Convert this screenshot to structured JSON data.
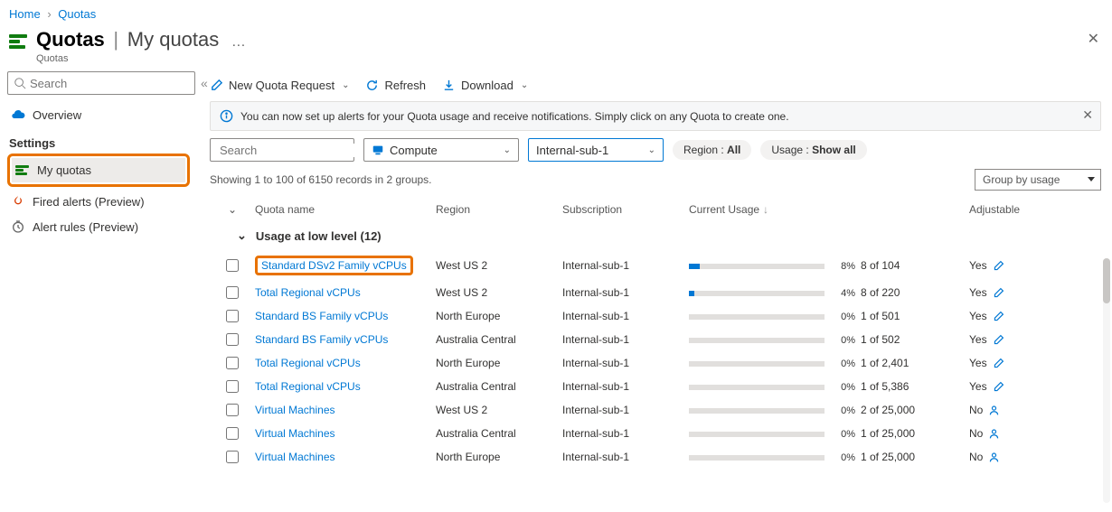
{
  "breadcrumb": {
    "home": "Home",
    "current": "Quotas"
  },
  "header": {
    "title": "Quotas",
    "subtitle": "My quotas",
    "service": "Quotas"
  },
  "sidebar": {
    "search_placeholder": "Search",
    "overview": "Overview",
    "section": "Settings",
    "my_quotas": "My quotas",
    "fired_alerts": "Fired alerts (Preview)",
    "alert_rules": "Alert rules (Preview)"
  },
  "toolbar": {
    "new": "New Quota Request",
    "refresh": "Refresh",
    "download": "Download"
  },
  "notice": "You can now set up alerts for your Quota usage and receive notifications. Simply click on any Quota to create one.",
  "filters": {
    "search_placeholder": "Search",
    "provider": "Compute",
    "subscription": "Internal-sub-1",
    "region_label": "Region :",
    "region_value": "All",
    "usage_label": "Usage :",
    "usage_value": "Show all"
  },
  "results": "Showing 1 to 100 of 6150 records in 2 groups.",
  "groupby": "Group by usage",
  "columns": {
    "name": "Quota name",
    "region": "Region",
    "sub": "Subscription",
    "usage": "Current Usage",
    "adj": "Adjustable"
  },
  "group_label": "Usage at low level (12)",
  "rows": [
    {
      "name": "Standard DSv2 Family vCPUs",
      "region": "West US 2",
      "sub": "Internal-sub-1",
      "pct": "8%",
      "fill": 8,
      "quota": "8 of 104",
      "adj": "Yes",
      "icon": "pen",
      "hl": true
    },
    {
      "name": "Total Regional vCPUs",
      "region": "West US 2",
      "sub": "Internal-sub-1",
      "pct": "4%",
      "fill": 4,
      "quota": "8 of 220",
      "adj": "Yes",
      "icon": "pen"
    },
    {
      "name": "Standard BS Family vCPUs",
      "region": "North Europe",
      "sub": "Internal-sub-1",
      "pct": "0%",
      "fill": 0,
      "quota": "1 of 501",
      "adj": "Yes",
      "icon": "pen"
    },
    {
      "name": "Standard BS Family vCPUs",
      "region": "Australia Central",
      "sub": "Internal-sub-1",
      "pct": "0%",
      "fill": 0,
      "quota": "1 of 502",
      "adj": "Yes",
      "icon": "pen"
    },
    {
      "name": "Total Regional vCPUs",
      "region": "North Europe",
      "sub": "Internal-sub-1",
      "pct": "0%",
      "fill": 0,
      "quota": "1 of 2,401",
      "adj": "Yes",
      "icon": "pen"
    },
    {
      "name": "Total Regional vCPUs",
      "region": "Australia Central",
      "sub": "Internal-sub-1",
      "pct": "0%",
      "fill": 0,
      "quota": "1 of 5,386",
      "adj": "Yes",
      "icon": "pen"
    },
    {
      "name": "Virtual Machines",
      "region": "West US 2",
      "sub": "Internal-sub-1",
      "pct": "0%",
      "fill": 0,
      "quota": "2 of 25,000",
      "adj": "No",
      "icon": "person"
    },
    {
      "name": "Virtual Machines",
      "region": "Australia Central",
      "sub": "Internal-sub-1",
      "pct": "0%",
      "fill": 0,
      "quota": "1 of 25,000",
      "adj": "No",
      "icon": "person"
    },
    {
      "name": "Virtual Machines",
      "region": "North Europe",
      "sub": "Internal-sub-1",
      "pct": "0%",
      "fill": 0,
      "quota": "1 of 25,000",
      "adj": "No",
      "icon": "person"
    }
  ]
}
